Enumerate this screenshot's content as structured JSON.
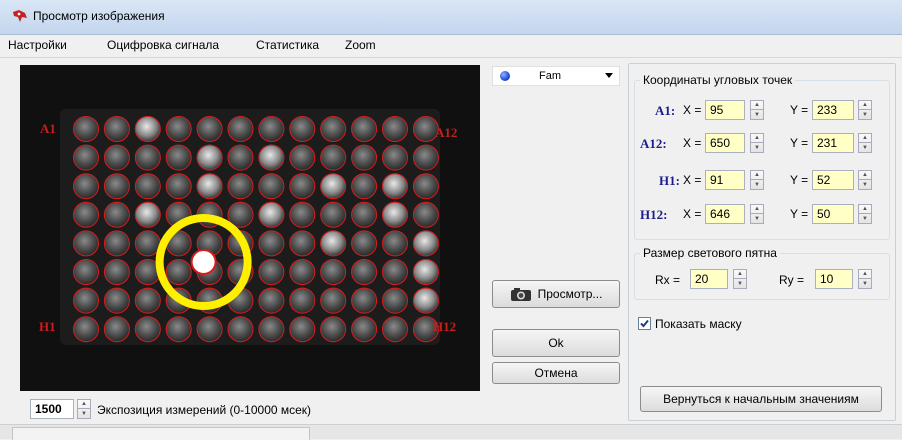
{
  "window": {
    "title": "Просмотр изображения"
  },
  "menu": [
    "Настройки",
    "Оцифровка сигнала",
    "Статистика",
    "Zoom"
  ],
  "image": {
    "corner_labels": {
      "a1": "A1",
      "a12": "A12",
      "h1": "H1",
      "h12": "H12"
    },
    "grid": {
      "rows": 8,
      "cols": 12
    },
    "highlight_well": {
      "row": 5,
      "col": 4
    }
  },
  "exposure": {
    "value": "1500",
    "label": "Экспозиция измерений (0-10000 мсек)"
  },
  "dye_select": {
    "value": "Fam",
    "dot_color": "#1f50d8"
  },
  "buttons": {
    "preview": "Просмотр...",
    "ok": "Ok",
    "cancel": "Отмена",
    "reset": "Вернуться к начальным значениям"
  },
  "coords": {
    "title": "Координаты угловых точек",
    "x_label": "X =",
    "y_label": "Y =",
    "rows": [
      {
        "name": "A1:",
        "x": "95",
        "y": "233"
      },
      {
        "name": "A12:",
        "x": "650",
        "y": "231"
      },
      {
        "name": "H1:",
        "x": "91",
        "y": "52"
      },
      {
        "name": "H12:",
        "x": "646",
        "y": "50"
      }
    ]
  },
  "spot": {
    "title": "Размер светового пятна",
    "rx_label": "Rx =",
    "rx": "20",
    "ry_label": "Ry =",
    "ry": "10"
  },
  "mask": {
    "label": "Показать маску",
    "checked": true
  }
}
